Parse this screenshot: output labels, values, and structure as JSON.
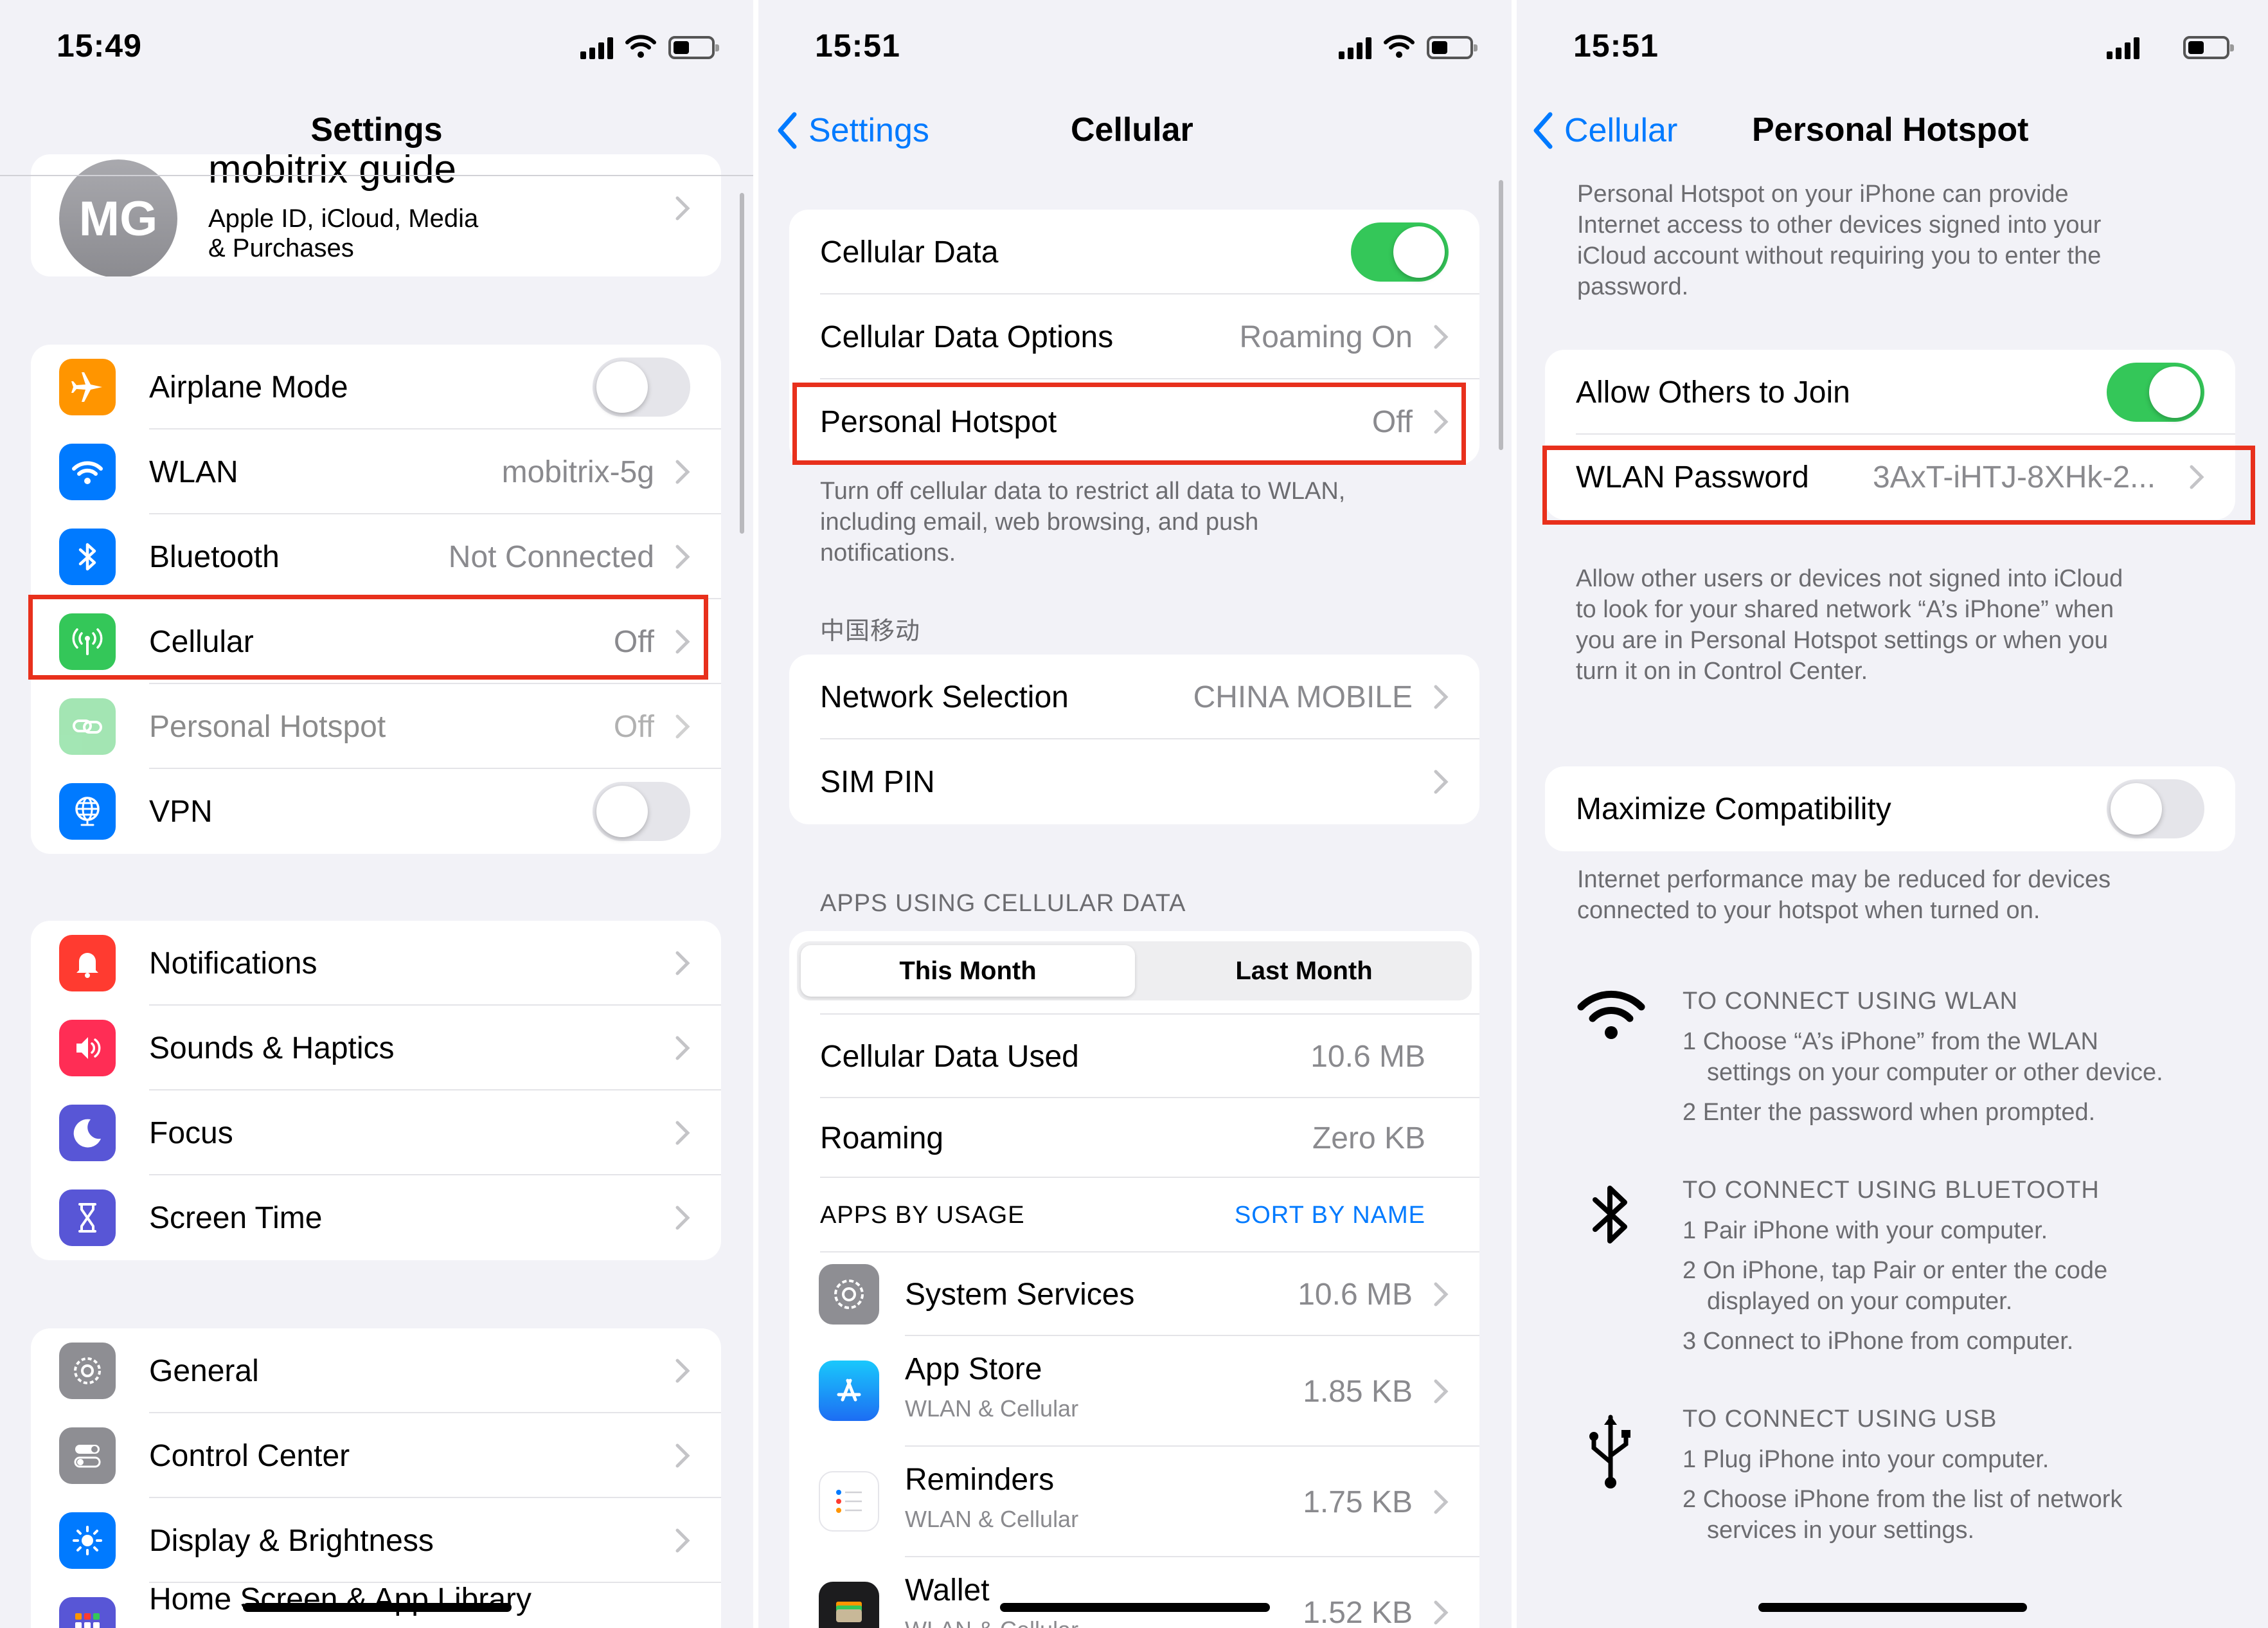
{
  "colors": {
    "accent": "#007aff",
    "toggle_on": "#34c759",
    "highlight": "#e8301c"
  },
  "settings": {
    "status_time": "15:49",
    "title": "Settings",
    "profile": {
      "initials": "MG",
      "name": "mobitrix guide",
      "subtitle_1": "Apple ID, iCloud, Media",
      "subtitle_2": "& Purchases"
    },
    "group1": [
      {
        "label": "Airplane Mode",
        "icon": "airplane-icon",
        "toggle": false
      },
      {
        "label": "WLAN",
        "icon": "wifi-icon",
        "value": "mobitrix-5g"
      },
      {
        "label": "Bluetooth",
        "icon": "bluetooth-icon",
        "value": "Not Connected"
      },
      {
        "label": "Cellular",
        "icon": "antenna-icon",
        "value": "Off",
        "highlighted": true
      },
      {
        "label": "Personal Hotspot",
        "icon": "link-icon",
        "value": "Off",
        "disabled": true
      },
      {
        "label": "VPN",
        "icon": "globe-icon",
        "toggle": false
      }
    ],
    "group2": [
      {
        "label": "Notifications",
        "icon": "bell-icon"
      },
      {
        "label": "Sounds & Haptics",
        "icon": "speaker-icon"
      },
      {
        "label": "Focus",
        "icon": "moon-icon"
      },
      {
        "label": "Screen Time",
        "icon": "hourglass-icon"
      }
    ],
    "group3": [
      {
        "label": "General",
        "icon": "gear-icon"
      },
      {
        "label": "Control Center",
        "icon": "switches-icon"
      },
      {
        "label": "Display & Brightness",
        "icon": "sun-icon"
      },
      {
        "label": "Home Screen & App Library",
        "icon": "grid-icon"
      }
    ]
  },
  "cellular": {
    "status_time": "15:51",
    "back_label": "Settings",
    "title": "Cellular",
    "rows": {
      "cellular_data": "Cellular Data",
      "data_options": "Cellular Data Options",
      "data_options_value": "Roaming On",
      "hotspot": "Personal Hotspot",
      "hotspot_value": "Off"
    },
    "footer_note": [
      "Turn off cellular data to restrict all data to WLAN,",
      "including email, web browsing, and push",
      "notifications."
    ],
    "carrier_header": "中国移动",
    "network_selection": "Network Selection",
    "network_value": "CHINA MOBILE",
    "sim_pin": "SIM PIN",
    "apps_header": "APPS USING CELLULAR DATA",
    "segments": [
      "This Month",
      "Last Month"
    ],
    "data_used_label": "Cellular Data Used",
    "data_used_value": "10.6 MB",
    "roaming_label": "Roaming",
    "roaming_value": "Zero KB",
    "apps_by_usage": "APPS BY USAGE",
    "sort_by_name": "SORT BY NAME",
    "apps": [
      {
        "name": "System Services",
        "sub": "",
        "value": "10.6 MB",
        "icon": "gear-icon"
      },
      {
        "name": "App Store",
        "sub": "WLAN & Cellular",
        "value": "1.85 KB",
        "icon": "app-store-icon"
      },
      {
        "name": "Reminders",
        "sub": "WLAN & Cellular",
        "value": "1.75 KB",
        "icon": "reminders-icon"
      },
      {
        "name": "Wallet",
        "sub": "WLAN & Cellular",
        "value": "1.52 KB",
        "icon": "wallet-icon"
      }
    ]
  },
  "hotspot": {
    "status_time": "15:51",
    "back_label": "Cellular",
    "title": "Personal Hotspot",
    "intro": [
      "Personal Hotspot on your iPhone can provide",
      "Internet access to other devices signed into your",
      "iCloud account without requiring you to enter the",
      "password."
    ],
    "allow_label": "Allow Others to Join",
    "password_label": "WLAN Password",
    "password_value": "3AxT-iHTJ-8XHk-2...",
    "allow_note": [
      "Allow other users or devices not signed into iCloud",
      "to look for your shared network “A’s iPhone” when",
      "you are in Personal Hotspot settings or when you",
      "turn it on in Control Center."
    ],
    "maximize_label": "Maximize Compatibility",
    "maximize_note": [
      "Internet performance may be reduced for devices",
      "connected to your hotspot when turned on."
    ],
    "wlan_head": "TO CONNECT USING WLAN",
    "wlan_steps": [
      "1 Choose “A’s iPhone” from the WLAN",
      "settings on your computer or other device.",
      "2 Enter the password when prompted."
    ],
    "bt_head": "TO CONNECT USING BLUETOOTH",
    "bt_steps": [
      "1 Pair iPhone with your computer.",
      "2 On iPhone, tap Pair or enter the code",
      "displayed on your computer.",
      "3 Connect to iPhone from computer."
    ],
    "usb_head": "TO CONNECT USING USB",
    "usb_steps": [
      "1 Plug iPhone into your computer.",
      "2 Choose iPhone from the list of network",
      "services in your settings."
    ]
  }
}
